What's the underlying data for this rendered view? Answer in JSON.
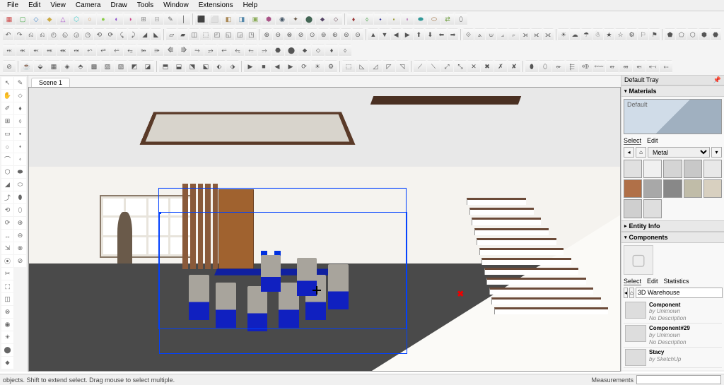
{
  "menu": [
    "File",
    "Edit",
    "View",
    "Camera",
    "Draw",
    "Tools",
    "Window",
    "Extensions",
    "Help"
  ],
  "scene_tab": "Scene 1",
  "status_hint": "objects. Shift to extend select. Drag mouse to select multiple.",
  "status_measure_label": "Measurements",
  "tray_title": "Default Tray",
  "panels": {
    "materials": "Materials",
    "entity_info": "Entity Info",
    "components": "Components"
  },
  "materials": {
    "current_name": "Default",
    "tab_select": "Select",
    "tab_edit": "Edit",
    "category": "Metal",
    "swatches": [
      "#e0e0e0",
      "#f0f0f0",
      "#d4d4d4",
      "#c8c8c8",
      "#e8e8e8",
      "#b07048",
      "#a8a8a8",
      "#888888",
      "#c0bca8",
      "#d8d0c0",
      "#cfcfcf",
      "#dedede"
    ]
  },
  "components": {
    "tab_select": "Select",
    "tab_edit": "Edit",
    "tab_stats": "Statistics",
    "source": "3D Warehouse",
    "items": [
      {
        "name": "Component",
        "by": "by Unknown",
        "desc": "No Description"
      },
      {
        "name": "Component#29",
        "by": "by Unknown",
        "desc": "No Description"
      },
      {
        "name": "Stacy",
        "by": "by SketchUp",
        "desc": ""
      }
    ]
  },
  "toolbar_rows": [
    [
      "▦",
      "▢",
      "◇",
      "◆",
      "△",
      "⬡",
      "○",
      "●",
      "◐",
      "◑",
      "⊞",
      "⊟",
      "✎",
      "│",
      "sep",
      "⬛",
      "⬜",
      "◧",
      "◨",
      "▣",
      "⬢",
      "◉",
      "✦",
      "⬤",
      "⬥",
      "⬦",
      "sep",
      "⬧",
      "⬨",
      "⬩",
      "⬪",
      "⬫",
      "⬬",
      "⬭",
      "⇄",
      "⬯"
    ],
    [
      "↶",
      "↷",
      "⎌",
      "⎌",
      "◴",
      "◵",
      "◶",
      "◷",
      "⟲",
      "⟳",
      "⤹",
      "⤸",
      "◢",
      "◣",
      "sep",
      "▱",
      "▰",
      "◫",
      "⬚",
      "◰",
      "◱",
      "◲",
      "◳",
      "sep",
      "⊕",
      "⊖",
      "⊗",
      "⊘",
      "⊙",
      "⊚",
      "⊛",
      "⊜",
      "⊝",
      "sep",
      "▲",
      "▼",
      "◀",
      "▶",
      "⬆",
      "⬇",
      "⬅",
      "➡",
      "sep",
      "⟐",
      "⟑",
      "⟒",
      "⟓",
      "⟔",
      "⟕",
      "⟖",
      "⟗",
      "sep",
      "☀",
      "☁",
      "☂",
      "☃",
      "★",
      "☆",
      "⚙",
      "⚐",
      "⚑",
      "sep",
      "⬟",
      "⬠",
      "⬡",
      "⬢",
      "⬣"
    ],
    [
      "⊘",
      "sep",
      "☕",
      "⬙",
      "▦",
      "◈",
      "⬘",
      "▩",
      "▨",
      "▧",
      "◩",
      "◪",
      "sep",
      "⬒",
      "⬓",
      "⬔",
      "⬕",
      "⬖",
      "⬗",
      "sep",
      "▶",
      "■",
      "◀",
      "▶",
      "⟳",
      "☀",
      "⚙",
      "sep",
      "⬚",
      "◺",
      "◿",
      "◸",
      "◹",
      "sep",
      "⟋",
      "⟍",
      "⤢",
      "⤡",
      "✕",
      "✖",
      "✗",
      "✘",
      "sep",
      "⬮",
      "⬯",
      "⬰",
      "⬱",
      "⬲",
      "⬳",
      "⬴",
      "⬵",
      "⬶",
      "⬷",
      "⬸"
    ]
  ],
  "toolbar_colors_row1": [
    "#c44",
    "#4a4",
    "#48c",
    "#ca4",
    "#a5c",
    "#4cc",
    "#c84",
    "#8c4",
    "#84c",
    "#c48",
    "#888",
    "#aaa",
    "#666",
    "#444",
    "",
    "#5a8",
    "#85a",
    "#a85",
    "#58a",
    "#8a5",
    "#a58",
    "#456",
    "#654",
    "#465",
    "#546",
    "#645",
    "",
    "#933",
    "#393",
    "#339",
    "#993",
    "#939",
    "#399",
    "#963",
    "#693"
  ],
  "left_tools": [
    "↖",
    "✋",
    "✐",
    "⊞",
    "▭",
    "○",
    "⌒",
    "⬡",
    "◢",
    "⤴",
    "⟲",
    "⟳",
    "↔",
    "⇲",
    "⦿",
    "✂",
    "⬚",
    "◫",
    "⊗",
    "◉",
    "☀",
    "⬤",
    "⬥",
    "✎",
    "⬦",
    "⬧",
    "⬨",
    "⬩",
    "⬪",
    "⬫",
    "⬬",
    "⬭",
    "⬮",
    "⬯",
    "⊕",
    "⊖",
    "⊗",
    "⊘"
  ]
}
